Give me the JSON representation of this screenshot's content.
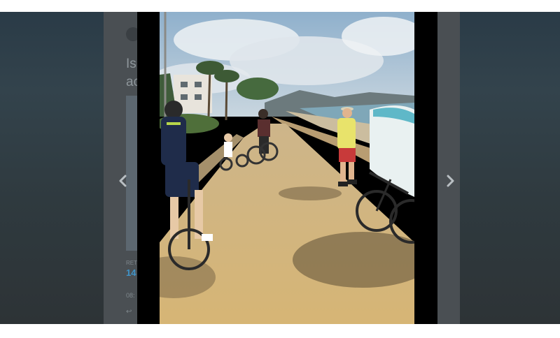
{
  "page": {
    "background": "#ffffff",
    "overlay_color": "#2c3134"
  },
  "tweet": {
    "headline_fragment": "Is\nac",
    "label_fragment": "RET",
    "count_fragment": "14",
    "time_fragment": "08:",
    "reply_fragment": "↩"
  },
  "viewer": {
    "prev_icon": "chevron-left-icon",
    "next_icon": "chevron-right-icon",
    "close_icon": "close-icon",
    "photo_description_icon": "photo"
  },
  "colors": {
    "sky": "#9fb8cf",
    "path": "#d1b27a",
    "sea": "#7fa7b8",
    "jersey": "#1f2c4a",
    "accent_green": "#b7d64a",
    "yellow_shirt": "#e8e36b",
    "red_shorts": "#c83a3a",
    "surfboard": "#e9f1f1",
    "link_blue": "#3f93c7"
  }
}
